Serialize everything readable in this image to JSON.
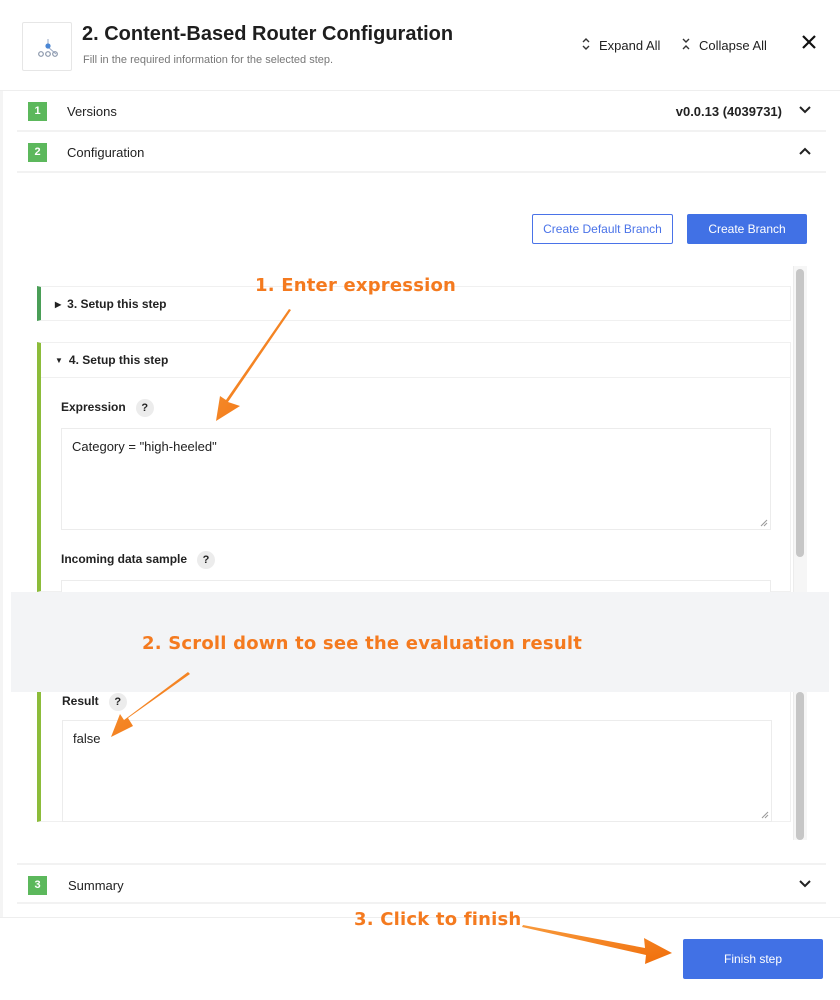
{
  "header": {
    "title": "2. Content-Based Router Configuration",
    "subtitle": "Fill in the required information for the selected step.",
    "expand_all_label": "Expand All",
    "collapse_all_label": "Collapse All",
    "icons": {
      "logo": "router-node-icon",
      "expand": "chevrons-expand-icon",
      "collapse": "chevrons-collapse-icon",
      "close": "close-icon"
    }
  },
  "accordion": [
    {
      "number": "1",
      "label": "Versions",
      "value": "v0.0.13 (4039731)",
      "state": "collapsed"
    },
    {
      "number": "2",
      "label": "Configuration",
      "value": "",
      "state": "expanded"
    },
    {
      "number": "3",
      "label": "Summary",
      "value": "",
      "state": "collapsed"
    }
  ],
  "configuration": {
    "create_default_branch_label": "Create Default Branch",
    "create_branch_label": "Create Branch",
    "steps": [
      {
        "label": "3. Setup this step",
        "state": "collapsed"
      },
      {
        "label": "4. Setup this step",
        "state": "expanded"
      }
    ],
    "expression": {
      "label": "Expression",
      "help": "?",
      "value": "Category = \"high-heeled\""
    },
    "incoming_sample": {
      "label": "Incoming data sample",
      "help": "?",
      "value": ""
    },
    "result": {
      "label": "Result",
      "help": "?",
      "value": "false"
    }
  },
  "annotations": {
    "step1": "1. Enter expression",
    "step2": "2. Scroll down to see the evaluation result",
    "step3": "3. Click to finish",
    "color": "#f47a1f"
  },
  "footer": {
    "finish_label": "Finish step"
  },
  "colors": {
    "primary": "#4171e5",
    "step_badge": "#5cb85c",
    "step3_border": "#4a9e57",
    "step4_border": "#8cbc3a"
  }
}
